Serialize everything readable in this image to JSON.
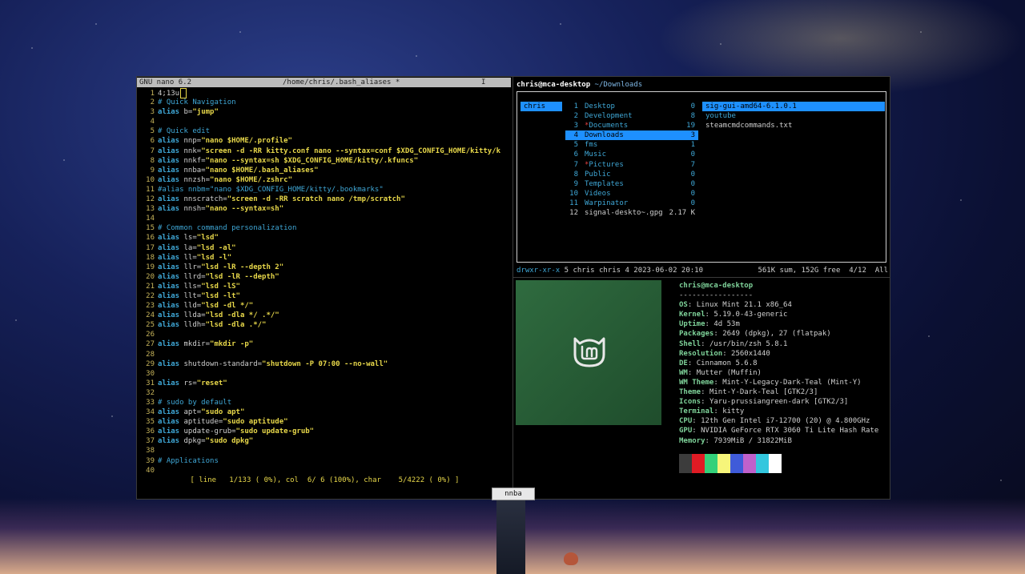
{
  "nano": {
    "title_left": "GNU nano 6.2",
    "title_file": "/home/chris/.bash_aliases *",
    "title_right": "I",
    "lines": [
      {
        "n": "1",
        "segments": [
          {
            "t": "4;13u",
            "c": "plain"
          }
        ],
        "cursor": true
      },
      {
        "n": "2",
        "segments": [
          {
            "t": "# Quick Navigation",
            "c": "comment"
          }
        ]
      },
      {
        "n": "3",
        "segments": [
          {
            "t": "alias",
            "c": "alias"
          },
          {
            "t": " b=",
            "c": "plain"
          },
          {
            "t": "\"jump\"",
            "c": "str"
          }
        ]
      },
      {
        "n": "4",
        "segments": []
      },
      {
        "n": "5",
        "segments": [
          {
            "t": "# Quick edit",
            "c": "comment"
          }
        ]
      },
      {
        "n": "6",
        "segments": [
          {
            "t": "alias",
            "c": "alias"
          },
          {
            "t": " nnp=",
            "c": "plain"
          },
          {
            "t": "\"nano $HOME/.profile\"",
            "c": "str"
          }
        ]
      },
      {
        "n": "7",
        "segments": [
          {
            "t": "alias",
            "c": "alias"
          },
          {
            "t": " nnk=",
            "c": "plain"
          },
          {
            "t": "\"screen -d -RR kitty.conf nano --syntax=conf $XDG_CONFIG_HOME/kitty/k",
            "c": "str"
          }
        ]
      },
      {
        "n": "8",
        "segments": [
          {
            "t": "alias",
            "c": "alias"
          },
          {
            "t": " nnkf=",
            "c": "plain"
          },
          {
            "t": "\"nano --syntax=sh $XDG_CONFIG_HOME/kitty/.kfuncs\"",
            "c": "str"
          }
        ]
      },
      {
        "n": "9",
        "segments": [
          {
            "t": "alias",
            "c": "alias"
          },
          {
            "t": " nnba=",
            "c": "plain"
          },
          {
            "t": "\"nano $HOME/.bash_aliases\"",
            "c": "str"
          }
        ]
      },
      {
        "n": "10",
        "segments": [
          {
            "t": "alias",
            "c": "alias"
          },
          {
            "t": " nnzsh=",
            "c": "plain"
          },
          {
            "t": "\"nano $HOME/.zshrc\"",
            "c": "str"
          }
        ]
      },
      {
        "n": "11",
        "segments": [
          {
            "t": "#alias nnbm=\"nano $XDG_CONFIG_HOME/kitty/.bookmarks\"",
            "c": "comment"
          }
        ]
      },
      {
        "n": "12",
        "segments": [
          {
            "t": "alias",
            "c": "alias"
          },
          {
            "t": " nnscratch=",
            "c": "plain"
          },
          {
            "t": "\"screen -d -RR scratch nano /tmp/scratch\"",
            "c": "str"
          }
        ]
      },
      {
        "n": "13",
        "segments": [
          {
            "t": "alias",
            "c": "alias"
          },
          {
            "t": " nnsh=",
            "c": "plain"
          },
          {
            "t": "\"nano --syntax=sh\"",
            "c": "str"
          }
        ]
      },
      {
        "n": "14",
        "segments": []
      },
      {
        "n": "15",
        "segments": [
          {
            "t": "# Common command personalization",
            "c": "comment"
          }
        ]
      },
      {
        "n": "16",
        "segments": [
          {
            "t": "alias",
            "c": "alias"
          },
          {
            "t": " ls=",
            "c": "plain"
          },
          {
            "t": "\"lsd\"",
            "c": "str"
          }
        ]
      },
      {
        "n": "17",
        "segments": [
          {
            "t": "alias",
            "c": "alias"
          },
          {
            "t": " la=",
            "c": "plain"
          },
          {
            "t": "\"lsd -al\"",
            "c": "str"
          }
        ]
      },
      {
        "n": "18",
        "segments": [
          {
            "t": "alias",
            "c": "alias"
          },
          {
            "t": " ll=",
            "c": "plain"
          },
          {
            "t": "\"lsd -l\"",
            "c": "str"
          }
        ]
      },
      {
        "n": "19",
        "segments": [
          {
            "t": "alias",
            "c": "alias"
          },
          {
            "t": " llr=",
            "c": "plain"
          },
          {
            "t": "\"lsd -lR --depth 2\"",
            "c": "str"
          }
        ]
      },
      {
        "n": "20",
        "segments": [
          {
            "t": "alias",
            "c": "alias"
          },
          {
            "t": " llrd=",
            "c": "plain"
          },
          {
            "t": "\"lsd -lR --depth\"",
            "c": "str"
          }
        ]
      },
      {
        "n": "21",
        "segments": [
          {
            "t": "alias",
            "c": "alias"
          },
          {
            "t": " lls=",
            "c": "plain"
          },
          {
            "t": "\"lsd -lS\"",
            "c": "str"
          }
        ]
      },
      {
        "n": "22",
        "segments": [
          {
            "t": "alias",
            "c": "alias"
          },
          {
            "t": " llt=",
            "c": "plain"
          },
          {
            "t": "\"lsd -lt\"",
            "c": "str"
          }
        ]
      },
      {
        "n": "23",
        "segments": [
          {
            "t": "alias",
            "c": "alias"
          },
          {
            "t": " lld=",
            "c": "plain"
          },
          {
            "t": "\"lsd -dl */\"",
            "c": "str"
          }
        ]
      },
      {
        "n": "24",
        "segments": [
          {
            "t": "alias",
            "c": "alias"
          },
          {
            "t": " llda=",
            "c": "plain"
          },
          {
            "t": "\"lsd -dla */ .*/\"",
            "c": "str"
          }
        ]
      },
      {
        "n": "25",
        "segments": [
          {
            "t": "alias",
            "c": "alias"
          },
          {
            "t": " lldh=",
            "c": "plain"
          },
          {
            "t": "\"lsd -dla .*/\"",
            "c": "str"
          }
        ]
      },
      {
        "n": "26",
        "segments": []
      },
      {
        "n": "27",
        "segments": [
          {
            "t": "alias",
            "c": "alias"
          },
          {
            "t": " mkdir=",
            "c": "plain"
          },
          {
            "t": "\"mkdir -p\"",
            "c": "str"
          }
        ]
      },
      {
        "n": "28",
        "segments": []
      },
      {
        "n": "29",
        "segments": [
          {
            "t": "alias",
            "c": "alias"
          },
          {
            "t": " shutdown-standard=",
            "c": "plain"
          },
          {
            "t": "\"shutdown -P 07:00 --no-wall\"",
            "c": "str"
          }
        ]
      },
      {
        "n": "30",
        "segments": []
      },
      {
        "n": "31",
        "segments": [
          {
            "t": "alias",
            "c": "alias"
          },
          {
            "t": " rs=",
            "c": "plain"
          },
          {
            "t": "\"reset\"",
            "c": "str"
          }
        ]
      },
      {
        "n": "32",
        "segments": []
      },
      {
        "n": "33",
        "segments": [
          {
            "t": "# sudo by default",
            "c": "comment"
          }
        ]
      },
      {
        "n": "34",
        "segments": [
          {
            "t": "alias",
            "c": "alias"
          },
          {
            "t": " apt=",
            "c": "plain"
          },
          {
            "t": "\"sudo apt\"",
            "c": "str"
          }
        ]
      },
      {
        "n": "35",
        "segments": [
          {
            "t": "alias",
            "c": "alias"
          },
          {
            "t": " aptitude=",
            "c": "plain"
          },
          {
            "t": "\"sudo aptitude\"",
            "c": "str"
          }
        ]
      },
      {
        "n": "36",
        "segments": [
          {
            "t": "alias",
            "c": "alias"
          },
          {
            "t": " update-grub=",
            "c": "plain"
          },
          {
            "t": "\"sudo update-grub\"",
            "c": "str"
          }
        ]
      },
      {
        "n": "37",
        "segments": [
          {
            "t": "alias",
            "c": "alias"
          },
          {
            "t": " dpkg=",
            "c": "plain"
          },
          {
            "t": "\"sudo dpkg\"",
            "c": "str"
          }
        ]
      },
      {
        "n": "38",
        "segments": []
      },
      {
        "n": "39",
        "segments": [
          {
            "t": "# Applications",
            "c": "comment"
          }
        ]
      },
      {
        "n": "40",
        "segments": []
      }
    ],
    "status": "[ line   1/133 ( 0%), col  6/ 6 (100%), char    5/4222 ( 0%) ]"
  },
  "lf": {
    "user_host": "chris@mca-desktop",
    "path": "~/Downloads",
    "parent_item": "chris",
    "dirs": [
      {
        "n": "1",
        "name": "Desktop",
        "count": "0",
        "type": "dir"
      },
      {
        "n": "2",
        "name": "Development",
        "count": "8",
        "type": "dir"
      },
      {
        "n": "3",
        "name": "Documents",
        "count": "19",
        "type": "dir",
        "marked": true
      },
      {
        "n": "4",
        "name": "Downloads",
        "count": "3",
        "type": "dir",
        "selected": true
      },
      {
        "n": "5",
        "name": "fms",
        "count": "1",
        "type": "dir"
      },
      {
        "n": "6",
        "name": "Music",
        "count": "0",
        "type": "dir"
      },
      {
        "n": "7",
        "name": "Pictures",
        "count": "7",
        "type": "dir",
        "marked": true
      },
      {
        "n": "8",
        "name": "Public",
        "count": "0",
        "type": "dir"
      },
      {
        "n": "9",
        "name": "Templates",
        "count": "0",
        "type": "dir"
      },
      {
        "n": "10",
        "name": "Videos",
        "count": "0",
        "type": "dir"
      },
      {
        "n": "11",
        "name": "Warpinator",
        "count": "0",
        "type": "dir"
      },
      {
        "n": "12",
        "name": "signal-deskto~.gpg",
        "count": "2.17 K",
        "type": "file"
      }
    ],
    "preview": [
      {
        "name": "sig-gui-amd64-6.1.0.1",
        "type": "dir",
        "selected": true
      },
      {
        "name": "youtube",
        "type": "dir"
      },
      {
        "name": "steamcmdcommands.txt",
        "type": "file"
      }
    ],
    "status_perm": "drwxr-xr-x",
    "status_info": "5 chris chris 4 2023-06-02 20:10",
    "status_right": "561K sum, 152G free  4/12  All"
  },
  "fastfetch": {
    "header": "chris@mca-desktop",
    "separator": "-----------------",
    "rows": [
      {
        "k": "OS",
        "v": "Linux Mint 21.1 x86_64"
      },
      {
        "k": "Kernel",
        "v": "5.19.0-43-generic"
      },
      {
        "k": "Uptime",
        "v": "4d 53m"
      },
      {
        "k": "Packages",
        "v": "2649 (dpkg), 27 (flatpak)"
      },
      {
        "k": "Shell",
        "v": "/usr/bin/zsh 5.8.1"
      },
      {
        "k": "Resolution",
        "v": "2560x1440"
      },
      {
        "k": "DE",
        "v": "Cinnamon 5.6.8"
      },
      {
        "k": "WM",
        "v": "Mutter (Muffin)"
      },
      {
        "k": "WM Theme",
        "v": "Mint-Y-Legacy-Dark-Teal (Mint-Y)"
      },
      {
        "k": "Theme",
        "v": "Mint-Y-Dark-Teal [GTK2/3]"
      },
      {
        "k": "Icons",
        "v": "Yaru-prussiangreen-dark [GTK2/3]"
      },
      {
        "k": "Terminal",
        "v": "kitty"
      },
      {
        "k": "CPU",
        "v": "12th Gen Intel i7-12700 (20) @ 4.800GHz"
      },
      {
        "k": "GPU",
        "v": "NVIDIA GeForce RTX 3060 Ti Lite Hash Rate"
      },
      {
        "k": "Memory",
        "v": "7939MiB / 31822MiB"
      }
    ],
    "palette": [
      "#3c3c3c",
      "#e01b24",
      "#33d17a",
      "#f6f57a",
      "#3f5bd9",
      "#c061cb",
      "#33c7de",
      "#ffffff"
    ]
  },
  "tab": {
    "label": "nnba"
  }
}
